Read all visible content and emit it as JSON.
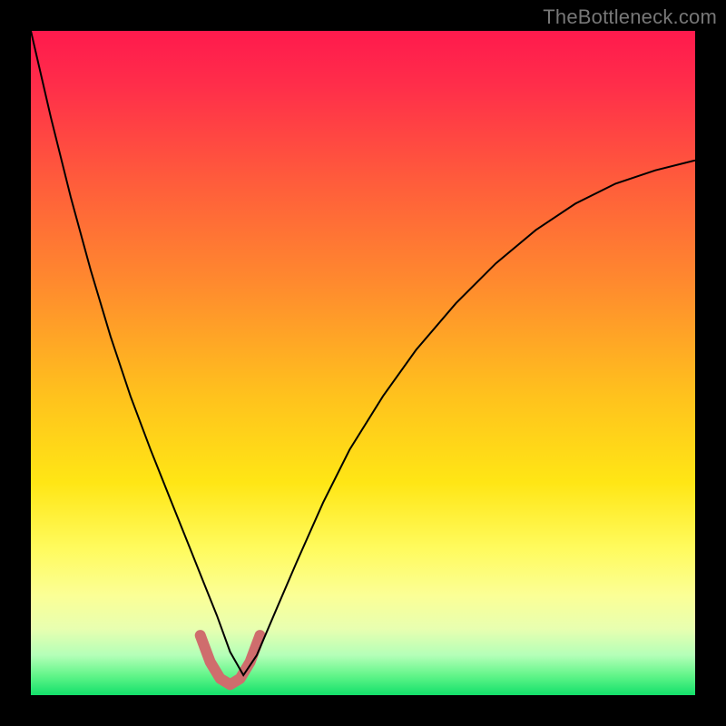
{
  "watermark": "TheBottleneck.com",
  "chart_data": {
    "type": "line",
    "title": "",
    "xlabel": "",
    "ylabel": "",
    "xlim": [
      0,
      1
    ],
    "ylim": [
      0,
      1
    ],
    "background": {
      "orientation": "vertical",
      "stops": [
        {
          "pos": 0.0,
          "color": "#ff1a4d"
        },
        {
          "pos": 0.08,
          "color": "#ff2d4a"
        },
        {
          "pos": 0.22,
          "color": "#ff5a3c"
        },
        {
          "pos": 0.38,
          "color": "#ff8a2e"
        },
        {
          "pos": 0.55,
          "color": "#ffc21d"
        },
        {
          "pos": 0.68,
          "color": "#ffe615"
        },
        {
          "pos": 0.78,
          "color": "#fffb5e"
        },
        {
          "pos": 0.85,
          "color": "#fbff96"
        },
        {
          "pos": 0.9,
          "color": "#e8ffb0"
        },
        {
          "pos": 0.94,
          "color": "#b4ffb8"
        },
        {
          "pos": 0.97,
          "color": "#63f58a"
        },
        {
          "pos": 1.0,
          "color": "#13e06a"
        }
      ]
    },
    "series": [
      {
        "name": "curve",
        "stroke": "#000000",
        "stroke_width": 2,
        "x": [
          0.0,
          0.03,
          0.06,
          0.09,
          0.12,
          0.15,
          0.18,
          0.21,
          0.24,
          0.26,
          0.28,
          0.3,
          0.32,
          0.34,
          0.37,
          0.4,
          0.44,
          0.48,
          0.53,
          0.58,
          0.64,
          0.7,
          0.76,
          0.82,
          0.88,
          0.94,
          1.0
        ],
        "y": [
          1.0,
          0.87,
          0.75,
          0.64,
          0.54,
          0.45,
          0.37,
          0.295,
          0.22,
          0.17,
          0.12,
          0.065,
          0.03,
          0.06,
          0.13,
          0.2,
          0.29,
          0.37,
          0.45,
          0.52,
          0.59,
          0.65,
          0.7,
          0.74,
          0.77,
          0.79,
          0.805
        ]
      },
      {
        "name": "bottom-highlight",
        "stroke": "#cf6d6d",
        "stroke_width": 12,
        "linecap": "round",
        "x": [
          0.255,
          0.27,
          0.285,
          0.3,
          0.315,
          0.33,
          0.345
        ],
        "y": [
          0.09,
          0.05,
          0.025,
          0.016,
          0.025,
          0.05,
          0.09
        ]
      }
    ]
  }
}
